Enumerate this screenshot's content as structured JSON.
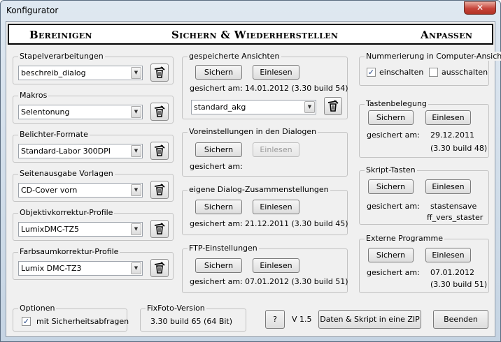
{
  "window": {
    "title": "Konfigurator",
    "close": "✕"
  },
  "header": {
    "left": "Bereinigen",
    "center": "Sichern & Wiederherstellen",
    "right": "Anpassen"
  },
  "left_groups": [
    {
      "title": "Stapelverarbeitungen",
      "value": "beschreib_dialog"
    },
    {
      "title": "Makros",
      "value": "Selentonung"
    },
    {
      "title": "Belichter-Formate",
      "value": "Standard-Labor 300DPI"
    },
    {
      "title": "Seitenausgabe Vorlagen",
      "value": "CD-Cover vorn"
    },
    {
      "title": "Objektivkorrektur-Profile",
      "value": "LumixDMC-TZ5"
    },
    {
      "title": "Farbsaumkorrektur-Profile",
      "value": "Lumix DMC-TZ3"
    }
  ],
  "middle": {
    "ansichten": {
      "title": "gespeicherte Ansichten",
      "save": "Sichern",
      "load": "Einlesen",
      "saved_label": "gesichert am:",
      "saved_value": "14.01.2012 (3.30 build 54)",
      "combo": "standard_akg"
    },
    "voreinstellungen": {
      "title": "Voreinstellungen in den Dialogen",
      "save": "Sichern",
      "load": "Einlesen",
      "saved_label": "gesichert am:"
    },
    "dialog": {
      "title": "eigene Dialog-Zusammenstellungen",
      "save": "Sichern",
      "load": "Einlesen",
      "saved_label": "gesichert am:",
      "saved_value": "21.12.2011 (3.30 build 45)"
    },
    "ftp": {
      "title": "FTP-Einstellungen",
      "save": "Sichern",
      "load": "Einlesen",
      "saved_label": "gesichert am:",
      "saved_value": "07.01.2012 (3.30 build 51)"
    }
  },
  "right": {
    "nummerierung": {
      "title": "Nummerierung in Computer-Ansicht",
      "on": "einschalten",
      "off": "ausschalten",
      "check": "✓"
    },
    "tasten": {
      "title": "Tastenbelegung",
      "save": "Sichern",
      "load": "Einlesen",
      "saved_label": "gesichert am:",
      "saved_date": "29.12.2011",
      "saved_build": "(3.30 build 48)"
    },
    "skript": {
      "title": "Skript-Tasten",
      "save": "Sichern",
      "load": "Einlesen",
      "saved_label": "gesichert am:",
      "line1": "stastensave",
      "line2": "ff_vers_staster"
    },
    "extern": {
      "title": "Externe Programme",
      "save": "Sichern",
      "load": "Einlesen",
      "saved_label": "gesichert am:",
      "saved_date": "07.01.2012",
      "saved_build": "(3.30 build 51)"
    }
  },
  "bottom": {
    "optionen": {
      "title": "Optionen",
      "check_label": "mit Sicherheitsabfragen",
      "check": "✓"
    },
    "version": {
      "title": "FixFoto-Version",
      "value": "3.30 build 65 (64 Bit)"
    },
    "help": "?",
    "vlabel": "V 1.5",
    "zip": "Daten & Skript in eine ZIP",
    "quit": "Beenden"
  }
}
